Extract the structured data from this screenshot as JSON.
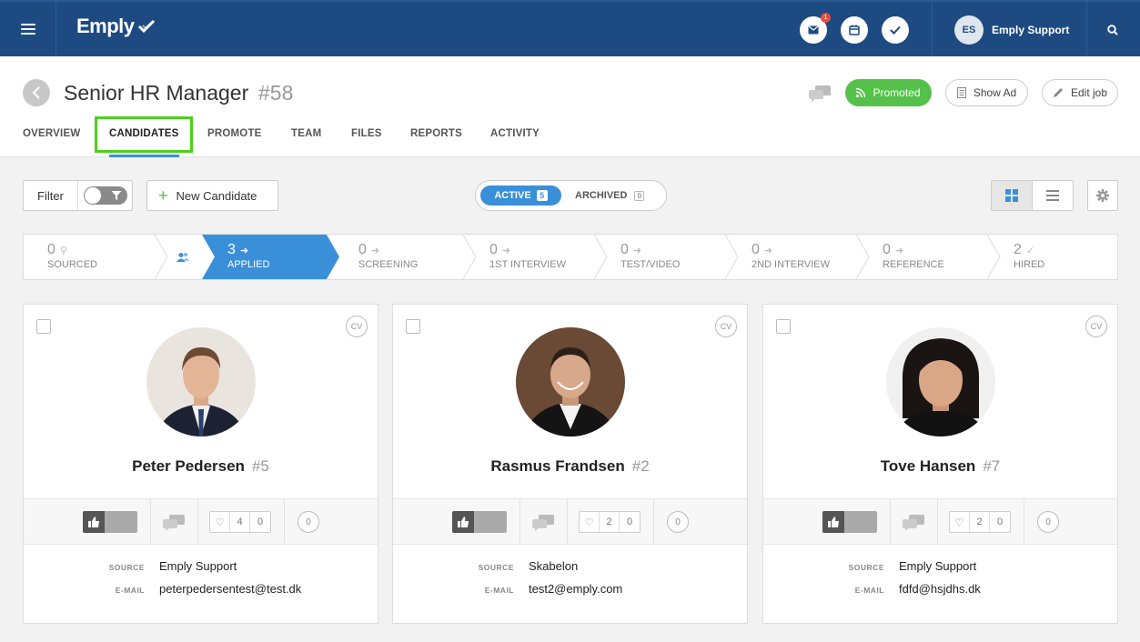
{
  "app": {
    "logo": "Emply",
    "user_initials": "ES",
    "user_name": "Emply Support",
    "notification_count": "1"
  },
  "colors": {
    "topbar": "#1d4a80",
    "accent": "#3a8fd9",
    "promoted": "#55c14a",
    "highlight": "#4bd11c"
  },
  "job": {
    "title": "Senior HR Manager",
    "number": "#58",
    "promoted_label": "Promoted",
    "show_ad_label": "Show Ad",
    "edit_job_label": "Edit job"
  },
  "tabs": [
    {
      "label": "OVERVIEW"
    },
    {
      "label": "CANDIDATES"
    },
    {
      "label": "PROMOTE"
    },
    {
      "label": "TEAM"
    },
    {
      "label": "FILES"
    },
    {
      "label": "REPORTS"
    },
    {
      "label": "ACTIVITY"
    }
  ],
  "toolbar": {
    "filter_label": "Filter",
    "new_candidate_label": "New Candidate",
    "active_label": "ACTIVE",
    "active_count": "5",
    "archived_label": "ARCHIVED",
    "archived_count": "0"
  },
  "pipeline": [
    {
      "count": "0",
      "label": "SOURCED",
      "icon": "search-icon"
    },
    {
      "count": "3",
      "label": "APPLIED",
      "icon": "arrow-right-icon"
    },
    {
      "count": "0",
      "label": "SCREENING",
      "icon": "arrow-right-icon"
    },
    {
      "count": "0",
      "label": "1ST INTERVIEW",
      "icon": "arrow-right-icon"
    },
    {
      "count": "0",
      "label": "TEST/VIDEO",
      "icon": "arrow-right-icon"
    },
    {
      "count": "0",
      "label": "2ND INTERVIEW",
      "icon": "arrow-right-icon"
    },
    {
      "count": "0",
      "label": "REFERENCE",
      "icon": "arrow-right-icon"
    },
    {
      "count": "2",
      "label": "HIRED",
      "icon": "check-icon"
    }
  ],
  "info_labels": {
    "source": "SOURCE",
    "email": "E-MAIL"
  },
  "candidates": [
    {
      "name": "Peter Pedersen",
      "id": "#5",
      "cv": "CV",
      "likes": "4",
      "dislikes": "0",
      "comments": "0",
      "source": "Emply Support",
      "email": "peterpedersentest@test.dk"
    },
    {
      "name": "Rasmus Frandsen",
      "id": "#2",
      "cv": "CV",
      "likes": "2",
      "dislikes": "0",
      "comments": "0",
      "source": "Skabelon",
      "email": "test2@emply.com"
    },
    {
      "name": "Tove Hansen",
      "id": "#7",
      "cv": "CV",
      "likes": "2",
      "dislikes": "0",
      "comments": "0",
      "source": "Emply Support",
      "email": "fdfd@hsjdhs.dk"
    }
  ]
}
